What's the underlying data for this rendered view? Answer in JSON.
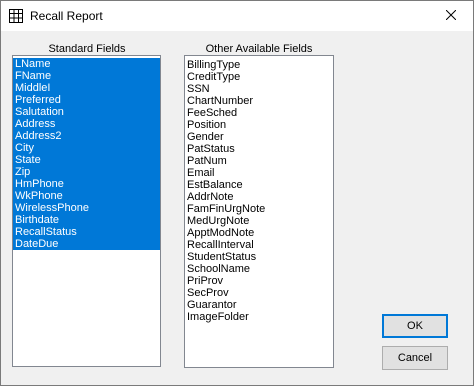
{
  "window": {
    "title": "Recall Report",
    "icon": "grid-icon"
  },
  "standard_fields": {
    "label": "Standard Fields",
    "items": [
      "LName",
      "FName",
      "MiddleI",
      "Preferred",
      "Salutation",
      "Address",
      "Address2",
      "City",
      "State",
      "Zip",
      "HmPhone",
      "WkPhone",
      "WirelessPhone",
      "Birthdate",
      "RecallStatus",
      "DateDue"
    ],
    "selected_all": true
  },
  "other_fields": {
    "label": "Other Available Fields",
    "items": [
      "BillingType",
      "CreditType",
      "SSN",
      "ChartNumber",
      "FeeSched",
      "Position",
      "Gender",
      "PatStatus",
      "PatNum",
      "Email",
      "EstBalance",
      "AddrNote",
      "FamFinUrgNote",
      "MedUrgNote",
      "ApptModNote",
      "RecallInterval",
      "StudentStatus",
      "SchoolName",
      "PriProv",
      "SecProv",
      "Guarantor",
      "ImageFolder"
    ]
  },
  "buttons": {
    "ok": "OK",
    "cancel": "Cancel"
  },
  "colors": {
    "selection": "#0078d7",
    "accent_border": "#0078d7"
  }
}
